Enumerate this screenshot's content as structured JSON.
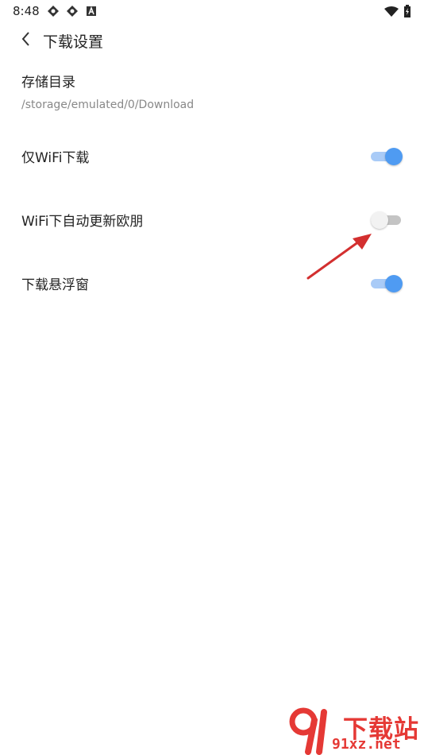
{
  "status_bar": {
    "time": "8:48",
    "left_icons": [
      "app-icon",
      "app-icon",
      "a-icon"
    ],
    "right_icons": [
      "wifi-icon",
      "battery-icon"
    ]
  },
  "header": {
    "title": "下载设置",
    "back_icon": "chevron-left-icon"
  },
  "storage": {
    "title": "存储目录",
    "path": "/storage/emulated/0/Download"
  },
  "settings": [
    {
      "label": "仅WiFi下载",
      "enabled": true
    },
    {
      "label": "WiFi下自动更新欧朋",
      "enabled": false
    },
    {
      "label": "下载悬浮窗",
      "enabled": true
    }
  ],
  "watermark": {
    "logo_text": "下载站",
    "site_text": "91xz.net"
  },
  "colors": {
    "accent": "#4f9bf2",
    "annotation": "#e53935"
  }
}
